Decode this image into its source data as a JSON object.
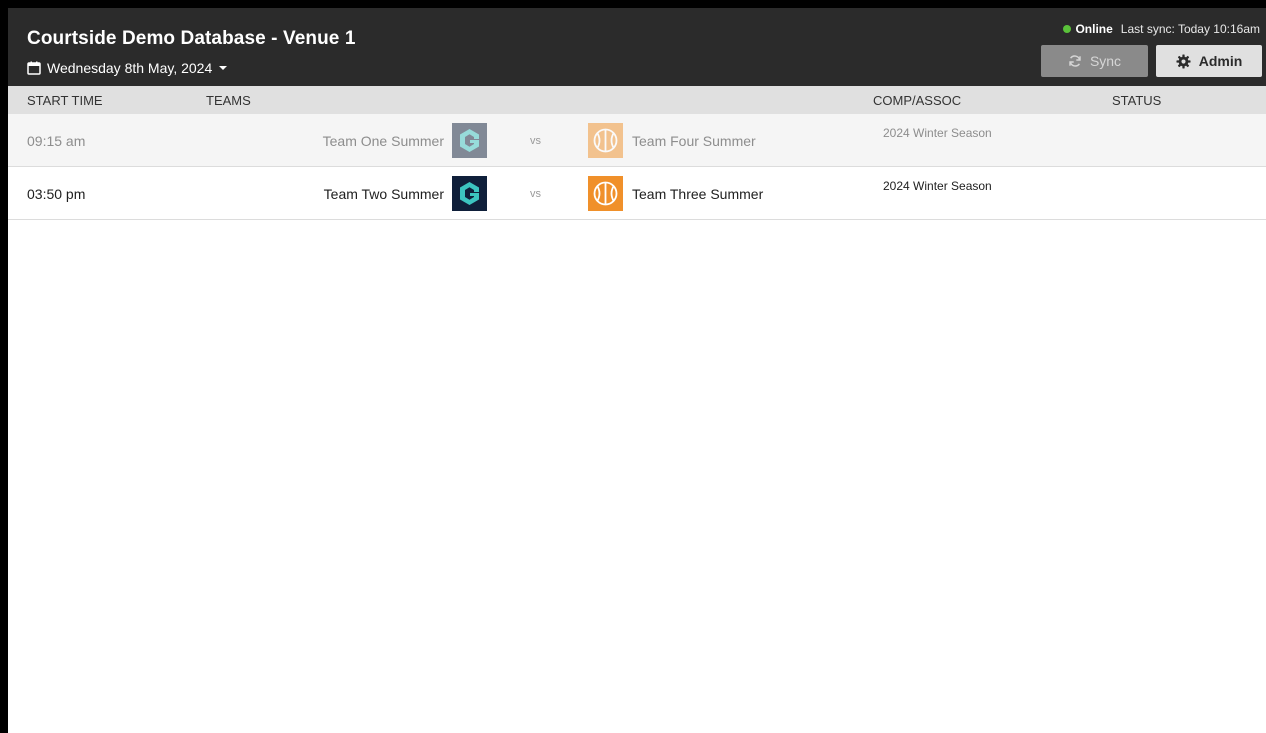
{
  "header": {
    "title": "Courtside Demo Database - Venue 1",
    "date": "Wednesday 8th May, 2024",
    "status_online": "Online",
    "last_sync": "Last sync: Today 10:16am",
    "sync_label": "Sync",
    "admin_label": "Admin"
  },
  "columns": {
    "start_time": "START TIME",
    "teams": "TEAMS",
    "comp": "COMP/ASSOC",
    "status": "STATUS"
  },
  "games": [
    {
      "time": "09:15 am",
      "home": "Team One Summer",
      "vs": "vs",
      "away": "Team Four Summer",
      "comp": "2024 Winter Season",
      "status": ""
    },
    {
      "time": "03:50 pm",
      "home": "Team Two Summer",
      "vs": "vs",
      "away": "Team Three Summer",
      "comp": "2024 Winter Season",
      "status": ""
    }
  ],
  "colors": {
    "header_bg": "#2b2b2b",
    "online_dot": "#5ac23a",
    "team_logo_dark": "#0f1f3a",
    "team_logo_accent": "#3cc4c0",
    "basketball_orange": "#f0902a"
  },
  "icons": {
    "calendar": "calendar-icon",
    "caret": "caret-down-icon",
    "sync": "sync-icon",
    "admin": "gear-icon",
    "home_logo": "hexagon-g-logo",
    "away_logo": "basketball-logo"
  }
}
